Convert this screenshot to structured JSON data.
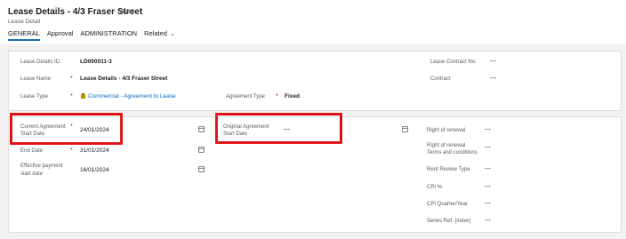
{
  "header": {
    "title": "Lease Details - 4/3 Fraser Street",
    "saved": "- Saved",
    "subtitle": "Lease Detail",
    "tabs": [
      "GENERAL",
      "Approval",
      "ADMINISTRATION",
      "Related"
    ]
  },
  "section1": {
    "lease_details_id_label": "Lease Details ID",
    "lease_details_id_value": "LD000011-3",
    "lease_name_label": "Lease Name",
    "lease_name_value": "Lease Details - 4/3 Fraser Street",
    "lease_type_label": "Lease Type",
    "lease_type_value": "Commercial - Agreement to Lease",
    "agreement_type_label": "Agreement Type",
    "agreement_type_value": "Fixed",
    "lease_contract_no_label": "Lease Contract No.",
    "lease_contract_no_value": "---",
    "contract_label": "Contract",
    "contract_value": "---"
  },
  "section2": {
    "current_agreement_label_1": "Current Agreement",
    "current_agreement_label_2": "Start Date",
    "current_agreement_value": "24/01/2024",
    "end_date_label": "End Date",
    "end_date_value": "31/01/2024",
    "effective_payment_label_1": "Effective payment",
    "effective_payment_label_2": "start date",
    "effective_payment_value": "16/01/2024",
    "original_agreement_label_1": "Original Agreement",
    "original_agreement_label_2": "Start Date",
    "original_agreement_value": "---",
    "right_of_renewal_label": "Right of renewal",
    "right_of_renewal_value": "---",
    "right_of_renewal_terms_label_1": "Right of renewal",
    "right_of_renewal_terms_label_2": "Terms and conditions",
    "right_of_renewal_terms_value": "---",
    "rent_review_type_label": "Rent Review Type",
    "rent_review_type_value": "---",
    "cpi_percent_label": "CPI %",
    "cpi_percent_value": "---",
    "cpi_quarter_year_label": "CPI Quarter/Year",
    "cpi_quarter_year_value": "---",
    "series_ref_label": "Series Ref. (index)",
    "series_ref_value": "---"
  },
  "required_marker": "*",
  "colors": {
    "accent": "#0f6cbd",
    "highlight": "#e0191f",
    "required": "#c50f1f"
  }
}
